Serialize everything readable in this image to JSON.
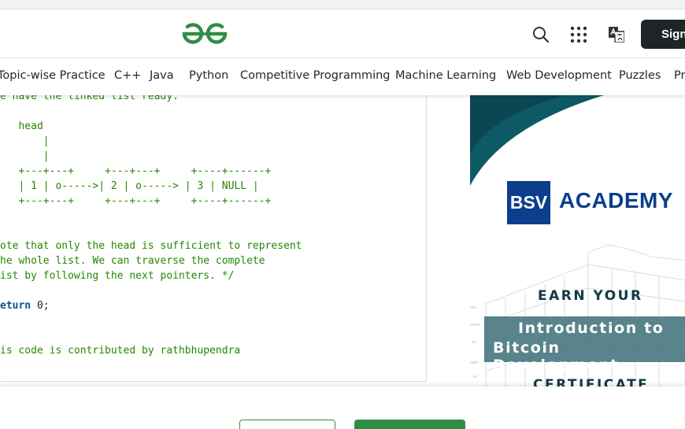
{
  "header": {
    "logo_name": "geeksforgeeks-logo",
    "signin_label": "Sign",
    "brand_color": "#2f8d46"
  },
  "nav": {
    "items": [
      {
        "label": "Topic-wise Practice"
      },
      {
        "label": "C++"
      },
      {
        "label": "Java"
      },
      {
        "label": "Python"
      },
      {
        "label": "Competitive Programming"
      },
      {
        "label": "Machine Learning"
      },
      {
        "label": "Web Development"
      },
      {
        "label": "Puzzles"
      },
      {
        "label": "Pr"
      }
    ]
  },
  "code": {
    "lines": [
      "e have the linked list ready.",
      "",
      "   head",
      "       |",
      "       |",
      "   +---+---+     +---+---+     +----+------+",
      "   | 1 | o----->| 2 | o-----> | 3 | NULL |",
      "   +---+---+     +---+---+     +----+------+",
      "",
      "",
      "ote that only the head is sufficient to represent",
      "he whole list. We can traverse the complete",
      "ist by following the next pointers. */",
      "",
      "",
      "",
      "",
      "is code is contributed by rathbhupendra"
    ],
    "return_keyword": "eturn",
    "return_value": " 0;"
  },
  "ad": {
    "brand_box": "BSV",
    "brand_word": "ACADEMY",
    "earn": "EARN YOUR",
    "title_line1": "Introduction to",
    "title_line2": "Bitcoin Development",
    "certificate": "CERTIFICATE",
    "accent_color": "#0c3e8c",
    "teal_color": "#0d5a66"
  }
}
